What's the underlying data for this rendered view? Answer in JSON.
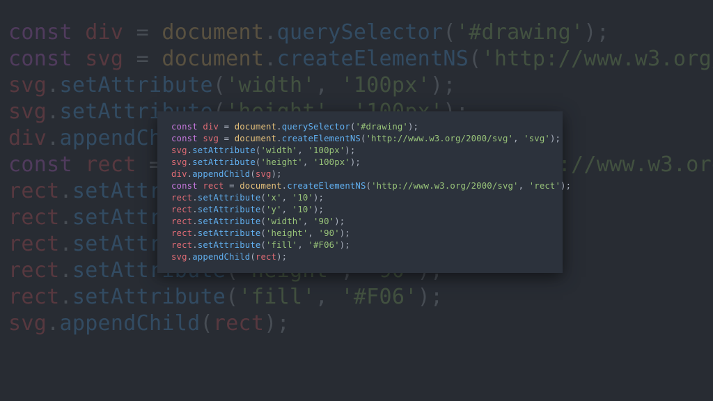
{
  "code_lines": [
    [
      {
        "c": "kw",
        "t": "const"
      },
      {
        "c": "pn",
        "t": " "
      },
      {
        "c": "var",
        "t": "div"
      },
      {
        "c": "pn",
        "t": " = "
      },
      {
        "c": "obj",
        "t": "document"
      },
      {
        "c": "pn",
        "t": "."
      },
      {
        "c": "fn",
        "t": "querySelector"
      },
      {
        "c": "pn",
        "t": "("
      },
      {
        "c": "str",
        "t": "'#drawing'"
      },
      {
        "c": "pn",
        "t": ");"
      }
    ],
    [
      {
        "c": "kw",
        "t": "const"
      },
      {
        "c": "pn",
        "t": " "
      },
      {
        "c": "var",
        "t": "svg"
      },
      {
        "c": "pn",
        "t": " = "
      },
      {
        "c": "obj",
        "t": "document"
      },
      {
        "c": "pn",
        "t": "."
      },
      {
        "c": "fn",
        "t": "createElementNS"
      },
      {
        "c": "pn",
        "t": "("
      },
      {
        "c": "str",
        "t": "'http://www.w3.org/2000/svg'"
      },
      {
        "c": "pn",
        "t": ", "
      },
      {
        "c": "str",
        "t": "'svg'"
      },
      {
        "c": "pn",
        "t": ");"
      }
    ],
    [
      {
        "c": "var",
        "t": "svg"
      },
      {
        "c": "pn",
        "t": "."
      },
      {
        "c": "fn",
        "t": "setAttribute"
      },
      {
        "c": "pn",
        "t": "("
      },
      {
        "c": "str",
        "t": "'width'"
      },
      {
        "c": "pn",
        "t": ", "
      },
      {
        "c": "str",
        "t": "'100px'"
      },
      {
        "c": "pn",
        "t": ");"
      }
    ],
    [
      {
        "c": "var",
        "t": "svg"
      },
      {
        "c": "pn",
        "t": "."
      },
      {
        "c": "fn",
        "t": "setAttribute"
      },
      {
        "c": "pn",
        "t": "("
      },
      {
        "c": "str",
        "t": "'height'"
      },
      {
        "c": "pn",
        "t": ", "
      },
      {
        "c": "str",
        "t": "'100px'"
      },
      {
        "c": "pn",
        "t": ");"
      }
    ],
    [
      {
        "c": "var",
        "t": "div"
      },
      {
        "c": "pn",
        "t": "."
      },
      {
        "c": "fn",
        "t": "appendChild"
      },
      {
        "c": "pn",
        "t": "("
      },
      {
        "c": "var",
        "t": "svg"
      },
      {
        "c": "pn",
        "t": ");"
      }
    ],
    [
      {
        "c": "kw",
        "t": "const"
      },
      {
        "c": "pn",
        "t": " "
      },
      {
        "c": "var",
        "t": "rect"
      },
      {
        "c": "pn",
        "t": " = "
      },
      {
        "c": "obj",
        "t": "document"
      },
      {
        "c": "pn",
        "t": "."
      },
      {
        "c": "fn",
        "t": "createElementNS"
      },
      {
        "c": "pn",
        "t": "("
      },
      {
        "c": "str",
        "t": "'http://www.w3.org/2000/svg'"
      },
      {
        "c": "pn",
        "t": ", "
      },
      {
        "c": "str",
        "t": "'rect'"
      },
      {
        "c": "pn",
        "t": ");"
      }
    ],
    [
      {
        "c": "var",
        "t": "rect"
      },
      {
        "c": "pn",
        "t": "."
      },
      {
        "c": "fn",
        "t": "setAttribute"
      },
      {
        "c": "pn",
        "t": "("
      },
      {
        "c": "str",
        "t": "'x'"
      },
      {
        "c": "pn",
        "t": ", "
      },
      {
        "c": "str",
        "t": "'10'"
      },
      {
        "c": "pn",
        "t": ");"
      }
    ],
    [
      {
        "c": "var",
        "t": "rect"
      },
      {
        "c": "pn",
        "t": "."
      },
      {
        "c": "fn",
        "t": "setAttribute"
      },
      {
        "c": "pn",
        "t": "("
      },
      {
        "c": "str",
        "t": "'y'"
      },
      {
        "c": "pn",
        "t": ", "
      },
      {
        "c": "str",
        "t": "'10'"
      },
      {
        "c": "pn",
        "t": ");"
      }
    ],
    [
      {
        "c": "var",
        "t": "rect"
      },
      {
        "c": "pn",
        "t": "."
      },
      {
        "c": "fn",
        "t": "setAttribute"
      },
      {
        "c": "pn",
        "t": "("
      },
      {
        "c": "str",
        "t": "'width'"
      },
      {
        "c": "pn",
        "t": ", "
      },
      {
        "c": "str",
        "t": "'90'"
      },
      {
        "c": "pn",
        "t": ");"
      }
    ],
    [
      {
        "c": "var",
        "t": "rect"
      },
      {
        "c": "pn",
        "t": "."
      },
      {
        "c": "fn",
        "t": "setAttribute"
      },
      {
        "c": "pn",
        "t": "("
      },
      {
        "c": "str",
        "t": "'height'"
      },
      {
        "c": "pn",
        "t": ", "
      },
      {
        "c": "str",
        "t": "'90'"
      },
      {
        "c": "pn",
        "t": ");"
      }
    ],
    [
      {
        "c": "var",
        "t": "rect"
      },
      {
        "c": "pn",
        "t": "."
      },
      {
        "c": "fn",
        "t": "setAttribute"
      },
      {
        "c": "pn",
        "t": "("
      },
      {
        "c": "str",
        "t": "'fill'"
      },
      {
        "c": "pn",
        "t": ", "
      },
      {
        "c": "str",
        "t": "'#F06'"
      },
      {
        "c": "pn",
        "t": ");"
      }
    ],
    [
      {
        "c": "var",
        "t": "svg"
      },
      {
        "c": "pn",
        "t": "."
      },
      {
        "c": "fn",
        "t": "appendChild"
      },
      {
        "c": "pn",
        "t": "("
      },
      {
        "c": "var",
        "t": "rect"
      },
      {
        "c": "pn",
        "t": ");"
      }
    ]
  ]
}
